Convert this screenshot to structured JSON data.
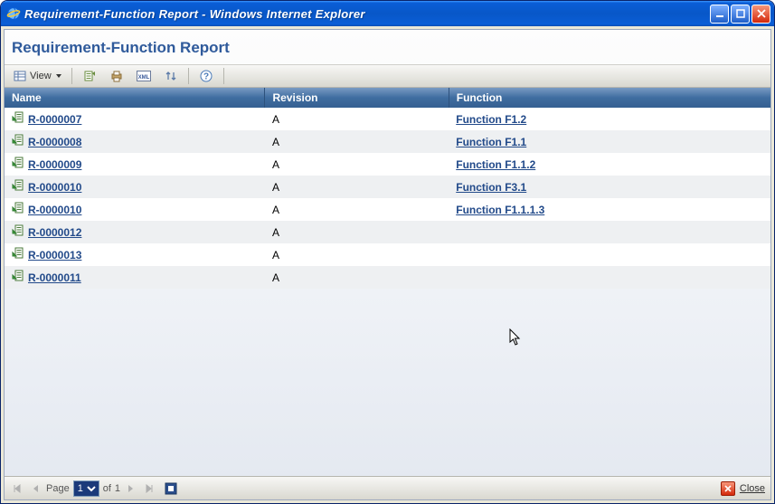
{
  "window": {
    "title": "Requirement-Function Report - Windows Internet Explorer"
  },
  "page": {
    "header": "Requirement-Function Report"
  },
  "toolbar": {
    "view_label": "View"
  },
  "columns": {
    "name": "Name",
    "revision": "Revision",
    "function": "Function"
  },
  "rows": [
    {
      "name": "R-0000007",
      "revision": "A",
      "function": "Function F1.2"
    },
    {
      "name": "R-0000008",
      "revision": "A",
      "function": "Function F1.1"
    },
    {
      "name": "R-0000009",
      "revision": "A",
      "function": "Function F1.1.2"
    },
    {
      "name": "R-0000010",
      "revision": "A",
      "function": "Function F3.1"
    },
    {
      "name": "R-0000010",
      "revision": "A",
      "function": "Function F1.1.1.3"
    },
    {
      "name": "R-0000012",
      "revision": "A",
      "function": ""
    },
    {
      "name": "R-0000013",
      "revision": "A",
      "function": ""
    },
    {
      "name": "R-0000011",
      "revision": "A",
      "function": ""
    }
  ],
  "pager": {
    "page_label": "Page",
    "current": "1",
    "of_label": "of",
    "total": "1"
  },
  "footer": {
    "close_label": "Close"
  }
}
